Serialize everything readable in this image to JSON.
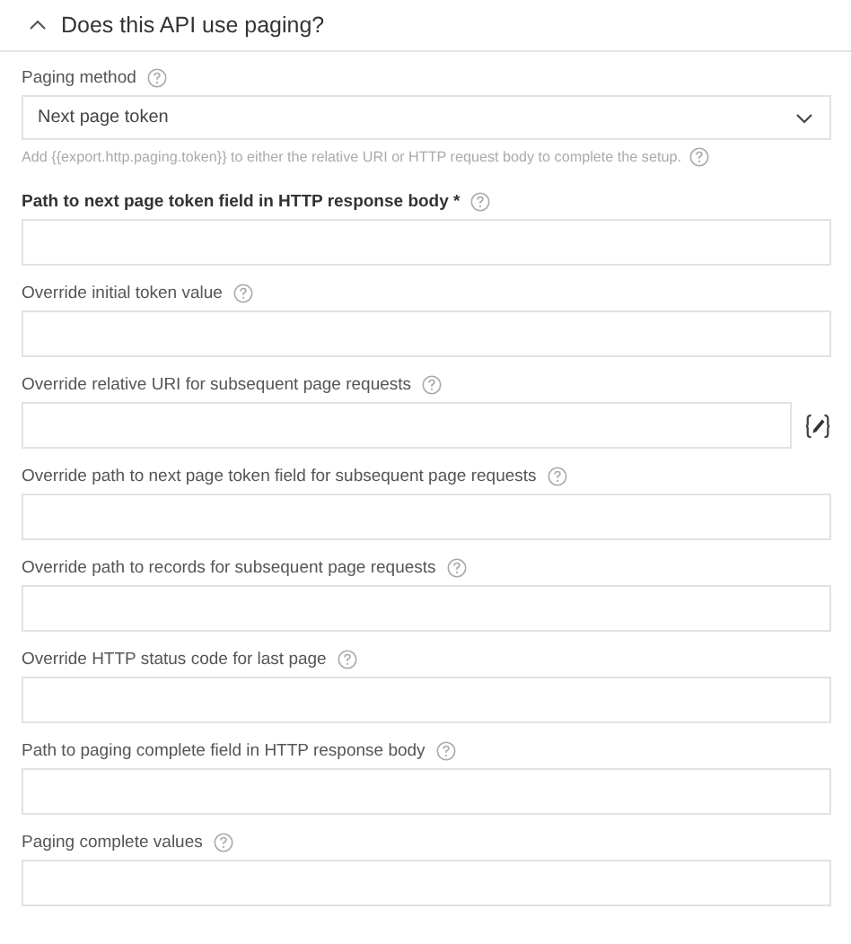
{
  "section": {
    "title": "Does this API use paging?",
    "expanded": true
  },
  "paging_method": {
    "label": "Paging method",
    "value": "Next page token",
    "hint": "Add {{export.http.paging.token}} to either the relative URI or HTTP request body to complete the setup."
  },
  "fields": [
    {
      "label": "Path to next page token field in HTTP response body *",
      "required": true,
      "kind": "plain"
    },
    {
      "label": "Override initial token value",
      "required": false,
      "kind": "plain"
    },
    {
      "label": "Override relative URI for subsequent page requests",
      "required": false,
      "kind": "with_editor"
    },
    {
      "label": "Override path to next page token field for subsequent page requests",
      "required": false,
      "kind": "plain"
    },
    {
      "label": "Override path to records for subsequent page requests",
      "required": false,
      "kind": "plain"
    },
    {
      "label": "Override HTTP status code for last page",
      "required": false,
      "kind": "plain"
    },
    {
      "label": "Path to paging complete field in HTTP response body",
      "required": false,
      "kind": "plain"
    },
    {
      "label": "Paging complete values",
      "required": false,
      "kind": "plain"
    }
  ]
}
